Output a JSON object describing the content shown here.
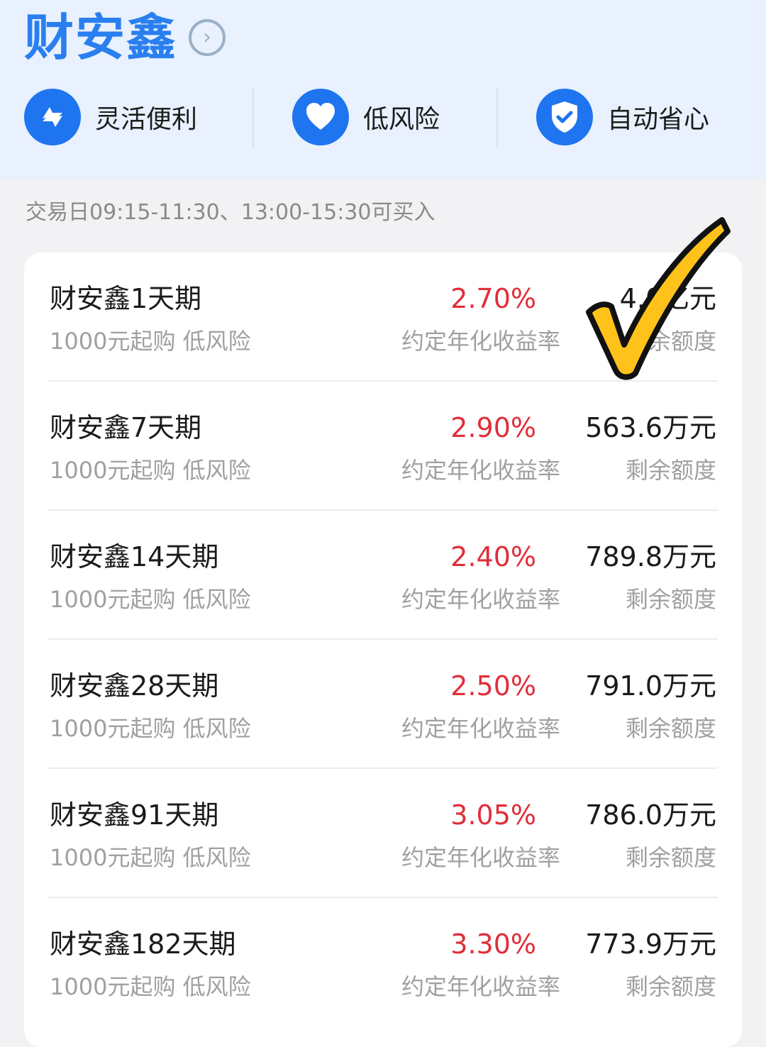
{
  "header": {
    "title": "财安鑫",
    "arrow_glyph": "›",
    "features": [
      {
        "label": "灵活便利",
        "icon": "refresh-icon"
      },
      {
        "label": "低风险",
        "icon": "heart-icon"
      },
      {
        "label": "自动省心",
        "icon": "shield-check-icon"
      }
    ]
  },
  "trade_hint": "交易日09:15-11:30、13:00-15:30可买入",
  "products": [
    {
      "name": "财安鑫1天期",
      "sub": "1000元起购 低风险",
      "rate": "2.70%",
      "rate_label": "约定年化收益率",
      "quota": "4.0亿元",
      "quota_label": "剩余额度"
    },
    {
      "name": "财安鑫7天期",
      "sub": "1000元起购 低风险",
      "rate": "2.90%",
      "rate_label": "约定年化收益率",
      "quota": "563.6万元",
      "quota_label": "剩余额度"
    },
    {
      "name": "财安鑫14天期",
      "sub": "1000元起购 低风险",
      "rate": "2.40%",
      "rate_label": "约定年化收益率",
      "quota": "789.8万元",
      "quota_label": "剩余额度"
    },
    {
      "name": "财安鑫28天期",
      "sub": "1000元起购 低风险",
      "rate": "2.50%",
      "rate_label": "约定年化收益率",
      "quota": "791.0万元",
      "quota_label": "剩余额度"
    },
    {
      "name": "财安鑫91天期",
      "sub": "1000元起购 低风险",
      "rate": "3.05%",
      "rate_label": "约定年化收益率",
      "quota": "786.0万元",
      "quota_label": "剩余额度"
    },
    {
      "name": "财安鑫182天期",
      "sub": "1000元起购 低风险",
      "rate": "3.30%",
      "rate_label": "约定年化收益率",
      "quota": "773.9万元",
      "quota_label": "剩余额度"
    }
  ],
  "colors": {
    "brand_blue": "#2a7ff0",
    "icon_blue": "#1f74f0",
    "rate_red": "#e02e3a",
    "check_yellow": "#ffc21a"
  },
  "overlay": {
    "icon": "checkmark-icon"
  }
}
